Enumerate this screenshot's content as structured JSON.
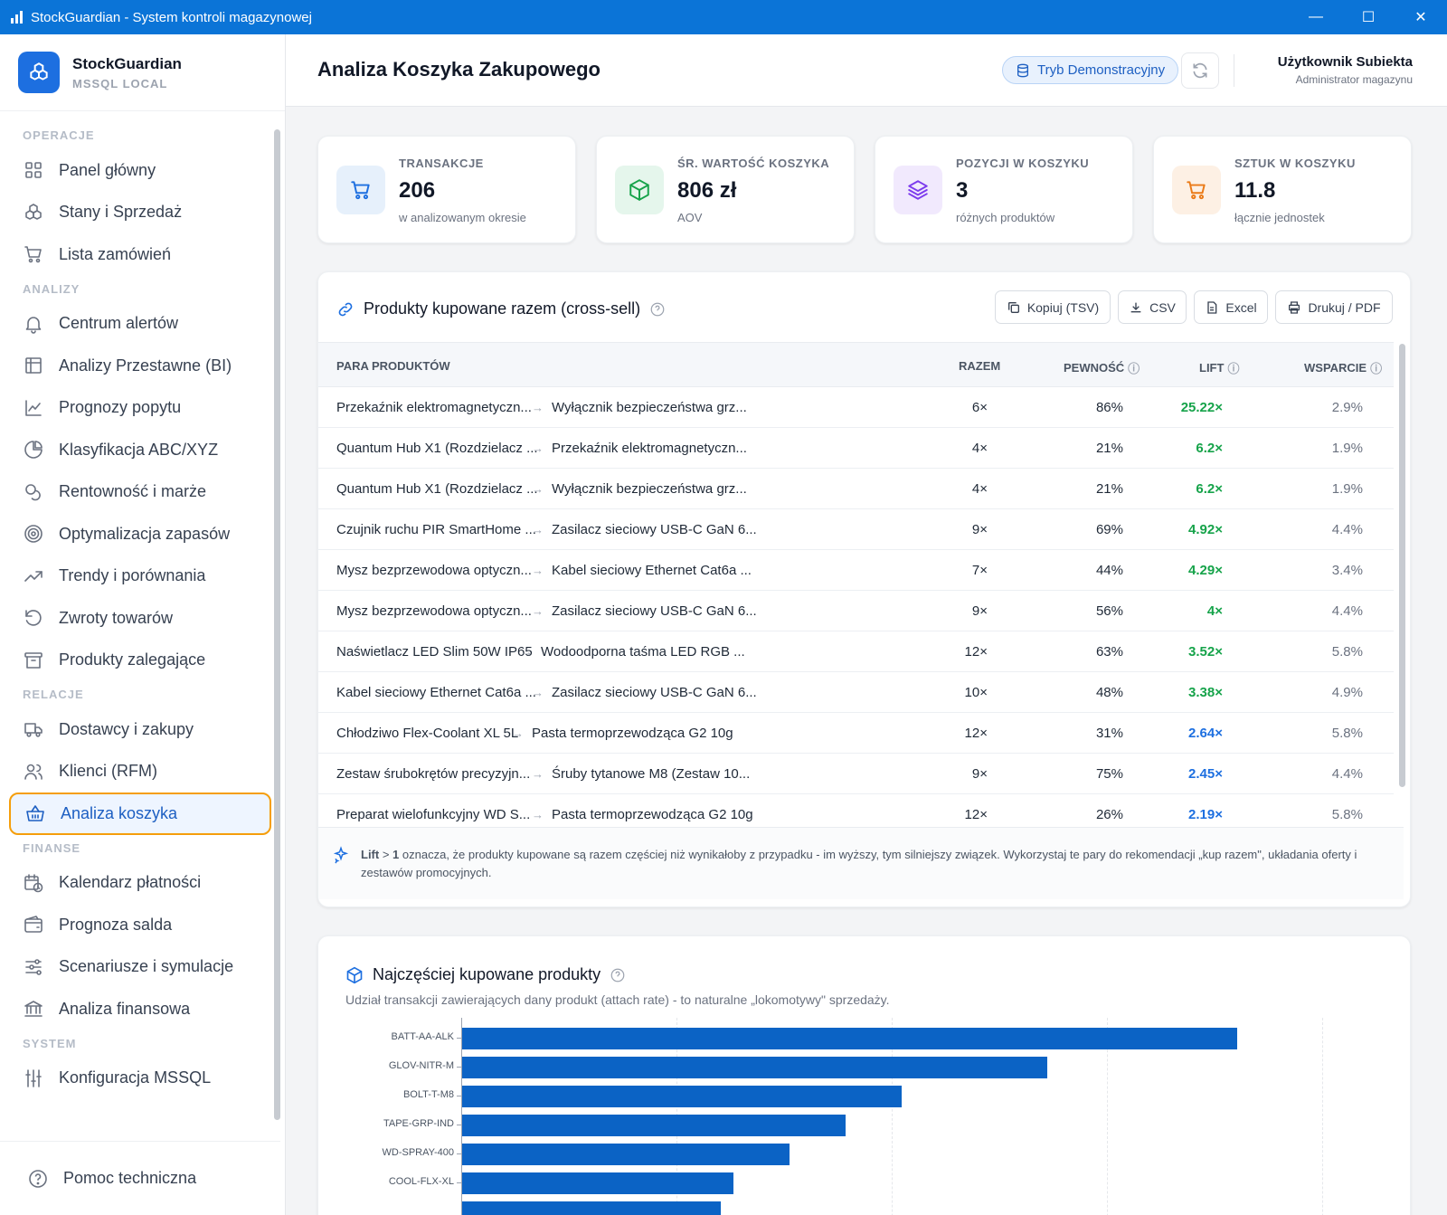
{
  "window": {
    "title": "StockGuardian - System kontroli magazynowej",
    "minimize": "—",
    "maximize": "☐",
    "close": "✕"
  },
  "brand": {
    "name": "StockGuardian",
    "sub": "MSSQL LOCAL"
  },
  "sidebar": {
    "sections": [
      {
        "label": "OPERACJE",
        "items": [
          {
            "label": "Panel główny",
            "icon": "grid-icon"
          },
          {
            "label": "Stany i Sprzedaż",
            "icon": "boxes-icon"
          },
          {
            "label": "Lista zamówień",
            "icon": "cart-icon"
          }
        ]
      },
      {
        "label": "ANALIZY",
        "items": [
          {
            "label": "Centrum alertów",
            "icon": "bell-icon"
          },
          {
            "label": "Analizy Przestawne (BI)",
            "icon": "table-icon"
          },
          {
            "label": "Prognozy popytu",
            "icon": "line-chart-icon"
          },
          {
            "label": "Klasyfikacja ABC/XYZ",
            "icon": "pie-icon"
          },
          {
            "label": "Rentowność i marże",
            "icon": "coins-icon"
          },
          {
            "label": "Optymalizacja zapasów",
            "icon": "target-icon"
          },
          {
            "label": "Trendy i porównania",
            "icon": "trend-icon"
          },
          {
            "label": "Zwroty towarów",
            "icon": "undo-icon"
          },
          {
            "label": "Produkty zalegające",
            "icon": "archive-icon"
          }
        ]
      },
      {
        "label": "RELACJE",
        "items": [
          {
            "label": "Dostawcy i zakupy",
            "icon": "truck-icon"
          },
          {
            "label": "Klienci (RFM)",
            "icon": "users-icon"
          },
          {
            "label": "Analiza koszyka",
            "icon": "basket-icon",
            "active": true
          }
        ]
      },
      {
        "label": "FINANSE",
        "items": [
          {
            "label": "Kalendarz płatności",
            "icon": "calendar-clock-icon"
          },
          {
            "label": "Prognoza salda",
            "icon": "wallet-icon"
          },
          {
            "label": "Scenariusze i symulacje",
            "icon": "sliders-icon"
          },
          {
            "label": "Analiza finansowa",
            "icon": "bank-icon"
          }
        ]
      },
      {
        "label": "SYSTEM",
        "items": [
          {
            "label": "Konfiguracja MSSQL",
            "icon": "settings-sliders-icon"
          }
        ]
      }
    ],
    "help": "Pomoc techniczna"
  },
  "header": {
    "title": "Analiza Koszyka Zakupowego",
    "demo": "Tryb Demonstracyjny",
    "user_name": "Użytkownik Subiekta",
    "user_role": "Administrator magazynu"
  },
  "kpis": [
    {
      "label": "TRANSAKCJE",
      "value": "206",
      "sub": "w analizowanym okresie",
      "icon": "cart-icon",
      "bg": "#e6f0fb",
      "color": "#1d6fe0"
    },
    {
      "label": "ŚR. WARTOŚĆ KOSZYKA",
      "value": "806 zł",
      "sub": "AOV",
      "icon": "box-icon",
      "bg": "#e5f6ec",
      "color": "#16a34a"
    },
    {
      "label": "POZYCJI W KOSZYKU",
      "value": "3",
      "sub": "różnych produktów",
      "icon": "layers-icon",
      "bg": "#f1e9fd",
      "color": "#7c3aed"
    },
    {
      "label": "SZTUK W KOSZYKU",
      "value": "11.8",
      "sub": "łącznie jednostek",
      "icon": "cart-icon",
      "bg": "#fdf0e4",
      "color": "#ea7a17"
    }
  ],
  "crosssell": {
    "title": "Produkty kupowane razem (cross-sell)",
    "buttons": {
      "copy": "Kopiuj (TSV)",
      "csv": "CSV",
      "excel": "Excel",
      "print": "Drukuj / PDF"
    },
    "columns": {
      "pair": "PARA PRODUKTÓW",
      "together": "RAZEM",
      "confidence": "PEWNOŚĆ",
      "lift": "LIFT",
      "support": "WSPARCIE"
    },
    "rows": [
      {
        "a": "Przekaźnik elektromagnetyczn...",
        "b": "Wyłącznik bezpieczeństwa grz...",
        "together": "6×",
        "confidence": "86%",
        "lift": "25.22×",
        "support": "2.9%",
        "lift_color": "#16a34a"
      },
      {
        "a": "Quantum Hub X1 (Rozdzielacz ...",
        "b": "Przekaźnik elektromagnetyczn...",
        "together": "4×",
        "confidence": "21%",
        "lift": "6.2×",
        "support": "1.9%",
        "lift_color": "#16a34a"
      },
      {
        "a": "Quantum Hub X1 (Rozdzielacz ...",
        "b": "Wyłącznik bezpieczeństwa grz...",
        "together": "4×",
        "confidence": "21%",
        "lift": "6.2×",
        "support": "1.9%",
        "lift_color": "#16a34a"
      },
      {
        "a": "Czujnik ruchu PIR SmartHome ...",
        "b": "Zasilacz sieciowy USB-C GaN 6...",
        "together": "9×",
        "confidence": "69%",
        "lift": "4.92×",
        "support": "4.4%",
        "lift_color": "#16a34a"
      },
      {
        "a": "Mysz bezprzewodowa optyczn...",
        "b": "Kabel sieciowy Ethernet Cat6a ...",
        "together": "7×",
        "confidence": "44%",
        "lift": "4.29×",
        "support": "3.4%",
        "lift_color": "#16a34a"
      },
      {
        "a": "Mysz bezprzewodowa optyczn...",
        "b": "Zasilacz sieciowy USB-C GaN 6...",
        "together": "9×",
        "confidence": "56%",
        "lift": "4×",
        "support": "4.4%",
        "lift_color": "#16a34a"
      },
      {
        "a": "Naświetlacz LED Slim 50W IP65",
        "b": "Wodoodporna taśma LED RGB ...",
        "together": "12×",
        "confidence": "63%",
        "lift": "3.52×",
        "support": "5.8%",
        "lift_color": "#16a34a"
      },
      {
        "a": "Kabel sieciowy Ethernet Cat6a ...",
        "b": "Zasilacz sieciowy USB-C GaN 6...",
        "together": "10×",
        "confidence": "48%",
        "lift": "3.38×",
        "support": "4.9%",
        "lift_color": "#16a34a"
      },
      {
        "a": "Chłodziwo Flex-Coolant XL 5L",
        "b": "Pasta termoprzewodząca G2 10g",
        "together": "12×",
        "confidence": "31%",
        "lift": "2.64×",
        "support": "5.8%",
        "lift_color": "#1d6fe0"
      },
      {
        "a": "Zestaw śrubokrętów precyzyjn...",
        "b": "Śruby tytanowe M8 (Zestaw 10...",
        "together": "9×",
        "confidence": "75%",
        "lift": "2.45×",
        "support": "4.4%",
        "lift_color": "#1d6fe0"
      },
      {
        "a": "Preparat wielofunkcyjny WD S...",
        "b": "Pasta termoprzewodząca G2 10g",
        "together": "12×",
        "confidence": "26%",
        "lift": "2.19×",
        "support": "5.8%",
        "lift_color": "#1d6fe0"
      }
    ],
    "note_bold1": "Lift",
    "note_mid": " > ",
    "note_bold2": "1",
    "note_text": " oznacza, że produkty kupowane są razem częściej niż wynikałoby z przypadku - im wyższy, tym silniejszy związek. Wykorzystaj te pary do rekomendacji „kup razem\", układania oferty i zestawów promocyjnych."
  },
  "top_products": {
    "title": "Najczęściej kupowane produkty",
    "subtitle": "Udział transakcji zawierających dany produkt (attach rate) - to naturalne „lokomotywy\" sprzedaży."
  },
  "chart_data": {
    "type": "bar",
    "orientation": "horizontal",
    "categories": [
      "BATT-AA-ALK",
      "GLOV-NITR-M",
      "BOLT-T-M8",
      "TAPE-GRP-IND",
      "WD-SPRAY-400",
      "COOL-FLX-XL"
    ],
    "values": [
      0.9,
      0.68,
      0.51,
      0.445,
      0.38,
      0.315
    ],
    "xlim": [
      0,
      1
    ],
    "grid": true,
    "color": "#0b63c5"
  }
}
